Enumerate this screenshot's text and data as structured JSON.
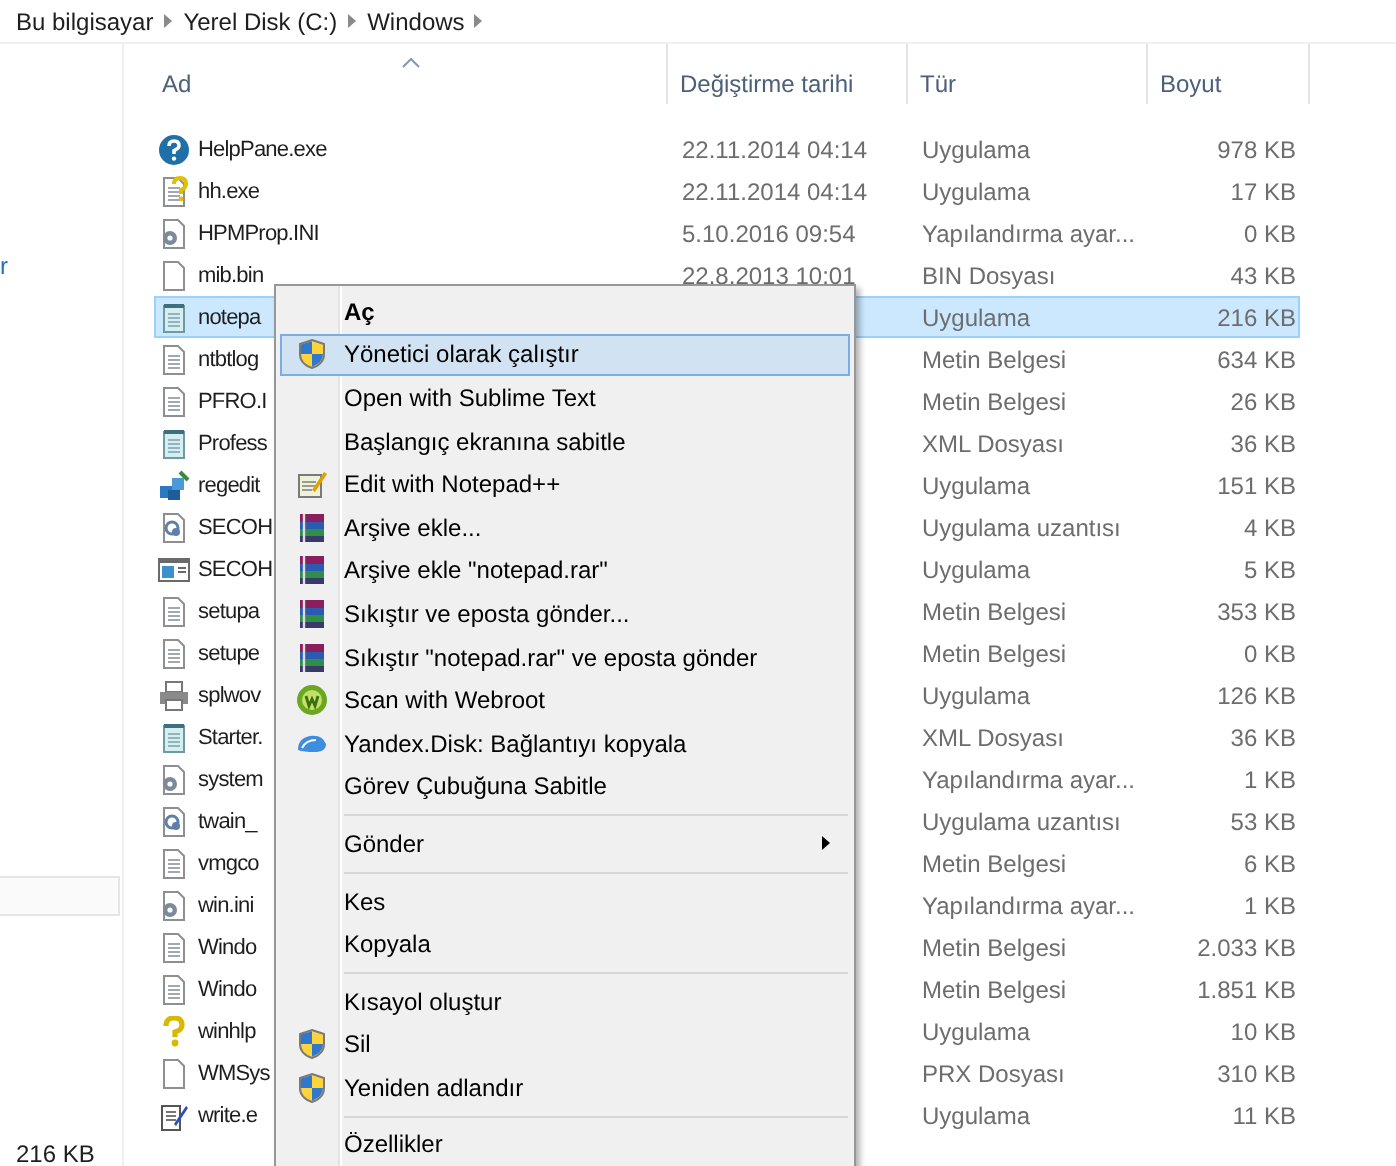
{
  "breadcrumb": [
    {
      "label": "Bu bilgisayar"
    },
    {
      "label": "Yerel Disk (C:)"
    },
    {
      "label": "Windows"
    }
  ],
  "navigation": {
    "items": [
      {
        "label": "r"
      }
    ]
  },
  "file_list": {
    "columns": [
      {
        "label": "Ad",
        "sorted": true
      },
      {
        "label": "Değiştirme tarihi",
        "sorted": false
      },
      {
        "label": "Tür",
        "sorted": false
      },
      {
        "label": "Boyut",
        "sorted": false
      }
    ],
    "rows": [
      {
        "kind": "help",
        "name": "HelpPane.exe",
        "modified": "22.11.2014 04:14",
        "type": "Uygulama",
        "size": "978 KB",
        "selected": false
      },
      {
        "kind": "helpdoc",
        "name": "hh.exe",
        "modified": "22.11.2014 04:14",
        "type": "Uygulama",
        "size": "17 KB",
        "selected": false
      },
      {
        "kind": "config",
        "name": "HPMProp.INI",
        "modified": "5.10.2016 09:54",
        "type": "Yapılandırma ayar...",
        "size": "0 KB",
        "selected": false
      },
      {
        "kind": "blank",
        "name": "mib.bin",
        "modified": "22.8.2013 10:01",
        "type": "BIN Dosyası",
        "size": "43 KB",
        "selected": false
      },
      {
        "kind": "notepad",
        "name": "notepa",
        "type": "Uygulama",
        "size": "216 KB",
        "selected": true
      },
      {
        "kind": "text",
        "name": "ntbtlog",
        "type": "Metin Belgesi",
        "size": "634 KB",
        "selected": false
      },
      {
        "kind": "text",
        "name": "PFRO.I",
        "type": "Metin Belgesi",
        "size": "26 KB",
        "selected": false
      },
      {
        "kind": "notepad",
        "name": "Profess",
        "type": "XML Dosyası",
        "size": "36 KB",
        "selected": false
      },
      {
        "kind": "regedit",
        "name": "regedit",
        "type": "Uygulama",
        "size": "151 KB",
        "selected": false
      },
      {
        "kind": "dll",
        "name": "SECOH",
        "type": "Uygulama uzantısı",
        "size": "4 KB",
        "selected": false
      },
      {
        "kind": "window",
        "name": "SECOH",
        "type": "Uygulama",
        "size": "5 KB",
        "selected": false
      },
      {
        "kind": "text",
        "name": "setupa",
        "type": "Metin Belgesi",
        "size": "353 KB",
        "selected": false
      },
      {
        "kind": "text",
        "name": "setupe",
        "type": "Metin Belgesi",
        "size": "0 KB",
        "selected": false
      },
      {
        "kind": "printer",
        "name": "splwov",
        "type": "Uygulama",
        "size": "126 KB",
        "selected": false
      },
      {
        "kind": "notepad",
        "name": "Starter.",
        "type": "XML Dosyası",
        "size": "36 KB",
        "selected": false
      },
      {
        "kind": "config",
        "name": "system",
        "type": "Yapılandırma ayar...",
        "size": "1 KB",
        "selected": false
      },
      {
        "kind": "dll",
        "name": "twain_",
        "type": "Uygulama uzantısı",
        "size": "53 KB",
        "selected": false
      },
      {
        "kind": "text",
        "name": "vmgco",
        "type": "Metin Belgesi",
        "size": "6 KB",
        "selected": false
      },
      {
        "kind": "config",
        "name": "win.ini",
        "type": "Yapılandırma ayar...",
        "size": "1 KB",
        "selected": false
      },
      {
        "kind": "text",
        "name": "Windo",
        "type": "Metin Belgesi",
        "size": "2.033 KB",
        "selected": false
      },
      {
        "kind": "text",
        "name": "Windo",
        "type": "Metin Belgesi",
        "size": "1.851 KB",
        "selected": false
      },
      {
        "kind": "question",
        "name": "winhlp",
        "type": "Uygulama",
        "size": "10 KB",
        "selected": false
      },
      {
        "kind": "blank",
        "name": "WMSys",
        "type": "PRX Dosyası",
        "size": "310 KB",
        "selected": false
      },
      {
        "kind": "write",
        "name": "write.e",
        "type": "Uygulama",
        "size": "11 KB",
        "selected": false
      }
    ]
  },
  "context_menu": {
    "items": [
      {
        "kind": "plain",
        "label": "Aç",
        "bold": true,
        "selected": false
      },
      {
        "kind": "shield",
        "label": "Yönetici olarak çalıştır",
        "selected": true
      },
      {
        "kind": "plain",
        "label": "Open with Sublime Text",
        "selected": false
      },
      {
        "kind": "plain",
        "label": "Başlangıç ekranına sabitle",
        "selected": false
      },
      {
        "kind": "notepadpp",
        "label": "Edit with Notepad++",
        "selected": false
      },
      {
        "kind": "rar",
        "label": "Arşive ekle...",
        "selected": false
      },
      {
        "kind": "rar",
        "label": "Arşive ekle \"notepad.rar\"",
        "selected": false
      },
      {
        "kind": "rar",
        "label": "Sıkıştır ve eposta gönder...",
        "selected": false
      },
      {
        "kind": "rar",
        "label": "Sıkıştır \"notepad.rar\" ve eposta gönder",
        "selected": false
      },
      {
        "kind": "webroot",
        "label": "Scan with Webroot",
        "selected": false
      },
      {
        "kind": "cloud",
        "label": "Yandex.Disk: Bağlantıyı kopyala",
        "selected": false
      },
      {
        "kind": "plain",
        "label": "Görev Çubuğuna Sabitle",
        "selected": false
      },
      {
        "kind": "separator"
      },
      {
        "kind": "plain",
        "label": "Gönder",
        "submenu": true,
        "selected": false
      },
      {
        "kind": "separator"
      },
      {
        "kind": "plain",
        "label": "Kes",
        "selected": false
      },
      {
        "kind": "plain",
        "label": "Kopyala",
        "selected": false
      },
      {
        "kind": "separator"
      },
      {
        "kind": "plain",
        "label": "Kısayol oluştur",
        "selected": false
      },
      {
        "kind": "shield",
        "label": "Sil",
        "selected": false
      },
      {
        "kind": "shield",
        "label": "Yeniden adlandır",
        "selected": false
      },
      {
        "kind": "separator"
      },
      {
        "kind": "plain",
        "label": "Özellikler",
        "selected": false
      }
    ]
  },
  "status_bar": {
    "text": "216 KB"
  }
}
